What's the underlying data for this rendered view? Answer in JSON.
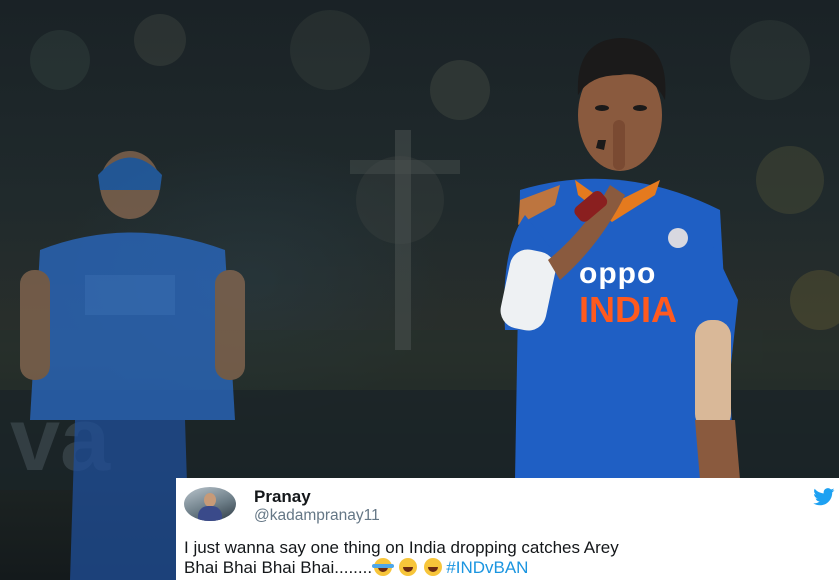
{
  "tweet": {
    "display_name": "Pranay",
    "handle": "@kadampranay11",
    "text_line1": "I just wanna say one thing on India dropping catches  Arey",
    "text_line2": "Bhai Bhai Bhai Bhai........",
    "hashtag": "#INDvBAN",
    "emojis": [
      "face-with-tears-of-joy",
      "grinning-face",
      "grinning-face"
    ]
  },
  "jersey": {
    "sponsor": "oppo",
    "country": "INDIA"
  },
  "colors": {
    "jersey_blue": "#1f5fc4",
    "twitter_blue": "#1da1f2",
    "hashtag": "#1b95e0"
  }
}
